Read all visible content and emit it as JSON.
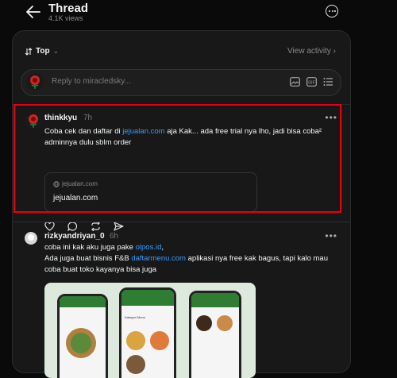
{
  "header": {
    "title": "Thread",
    "views": "4.1K views"
  },
  "sort": {
    "label": "Top",
    "view_activity": "View activity"
  },
  "reply": {
    "placeholder": "Reply to miracledsky..."
  },
  "posts": [
    {
      "username": "thinkkyu",
      "time": "7h",
      "text_before": "Coba cek dan daftar di ",
      "link": "jejualan.com",
      "text_after": " aja Kak... ada free trial nya lho, jadi bisa coba² adminnya dulu sblm order",
      "card": {
        "domain": "jejualan.com",
        "title": "jejualan.com"
      }
    },
    {
      "username": "rizkyandriyan_0",
      "time": "6h",
      "line1_before": "coba ini kak aku juga pake ",
      "line1_link": "olpos.id",
      "line1_after": ",",
      "line2_before": "Ada juga buat bisnis F&B ",
      "line2_link": "daftarmenu.com",
      "line2_after": " aplikasi nya free kak bagus, tapi kalo mau coba buat toko kayanya bisa juga",
      "image_text": {
        "label1": "Kategori Menu"
      }
    }
  ],
  "colors": {
    "highlight": "#e60012",
    "link": "#3a9bff",
    "background": "#0a0a0a",
    "panel": "#181818"
  }
}
